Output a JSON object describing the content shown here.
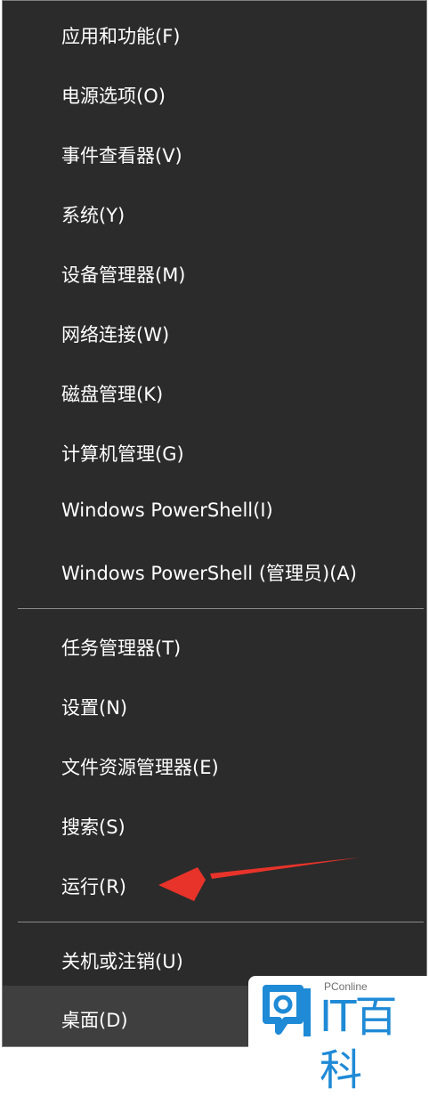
{
  "menu": {
    "group1": [
      "应用和功能(F)",
      "电源选项(O)",
      "事件查看器(V)",
      "系统(Y)",
      "设备管理器(M)",
      "网络连接(W)",
      "磁盘管理(K)",
      "计算机管理(G)",
      "Windows PowerShell(I)",
      "Windows PowerShell (管理员)(A)"
    ],
    "group2": [
      "任务管理器(T)",
      "设置(N)",
      "文件资源管理器(E)",
      "搜索(S)",
      "运行(R)"
    ],
    "group3": [
      "关机或注销(U)",
      "桌面(D)"
    ]
  },
  "annotation": {
    "arrow_color": "#e8332a",
    "points_to": "运行(R)"
  },
  "watermark": {
    "small_text": "PConline",
    "big_text": "IT百科",
    "color": "#1f8ad6"
  }
}
